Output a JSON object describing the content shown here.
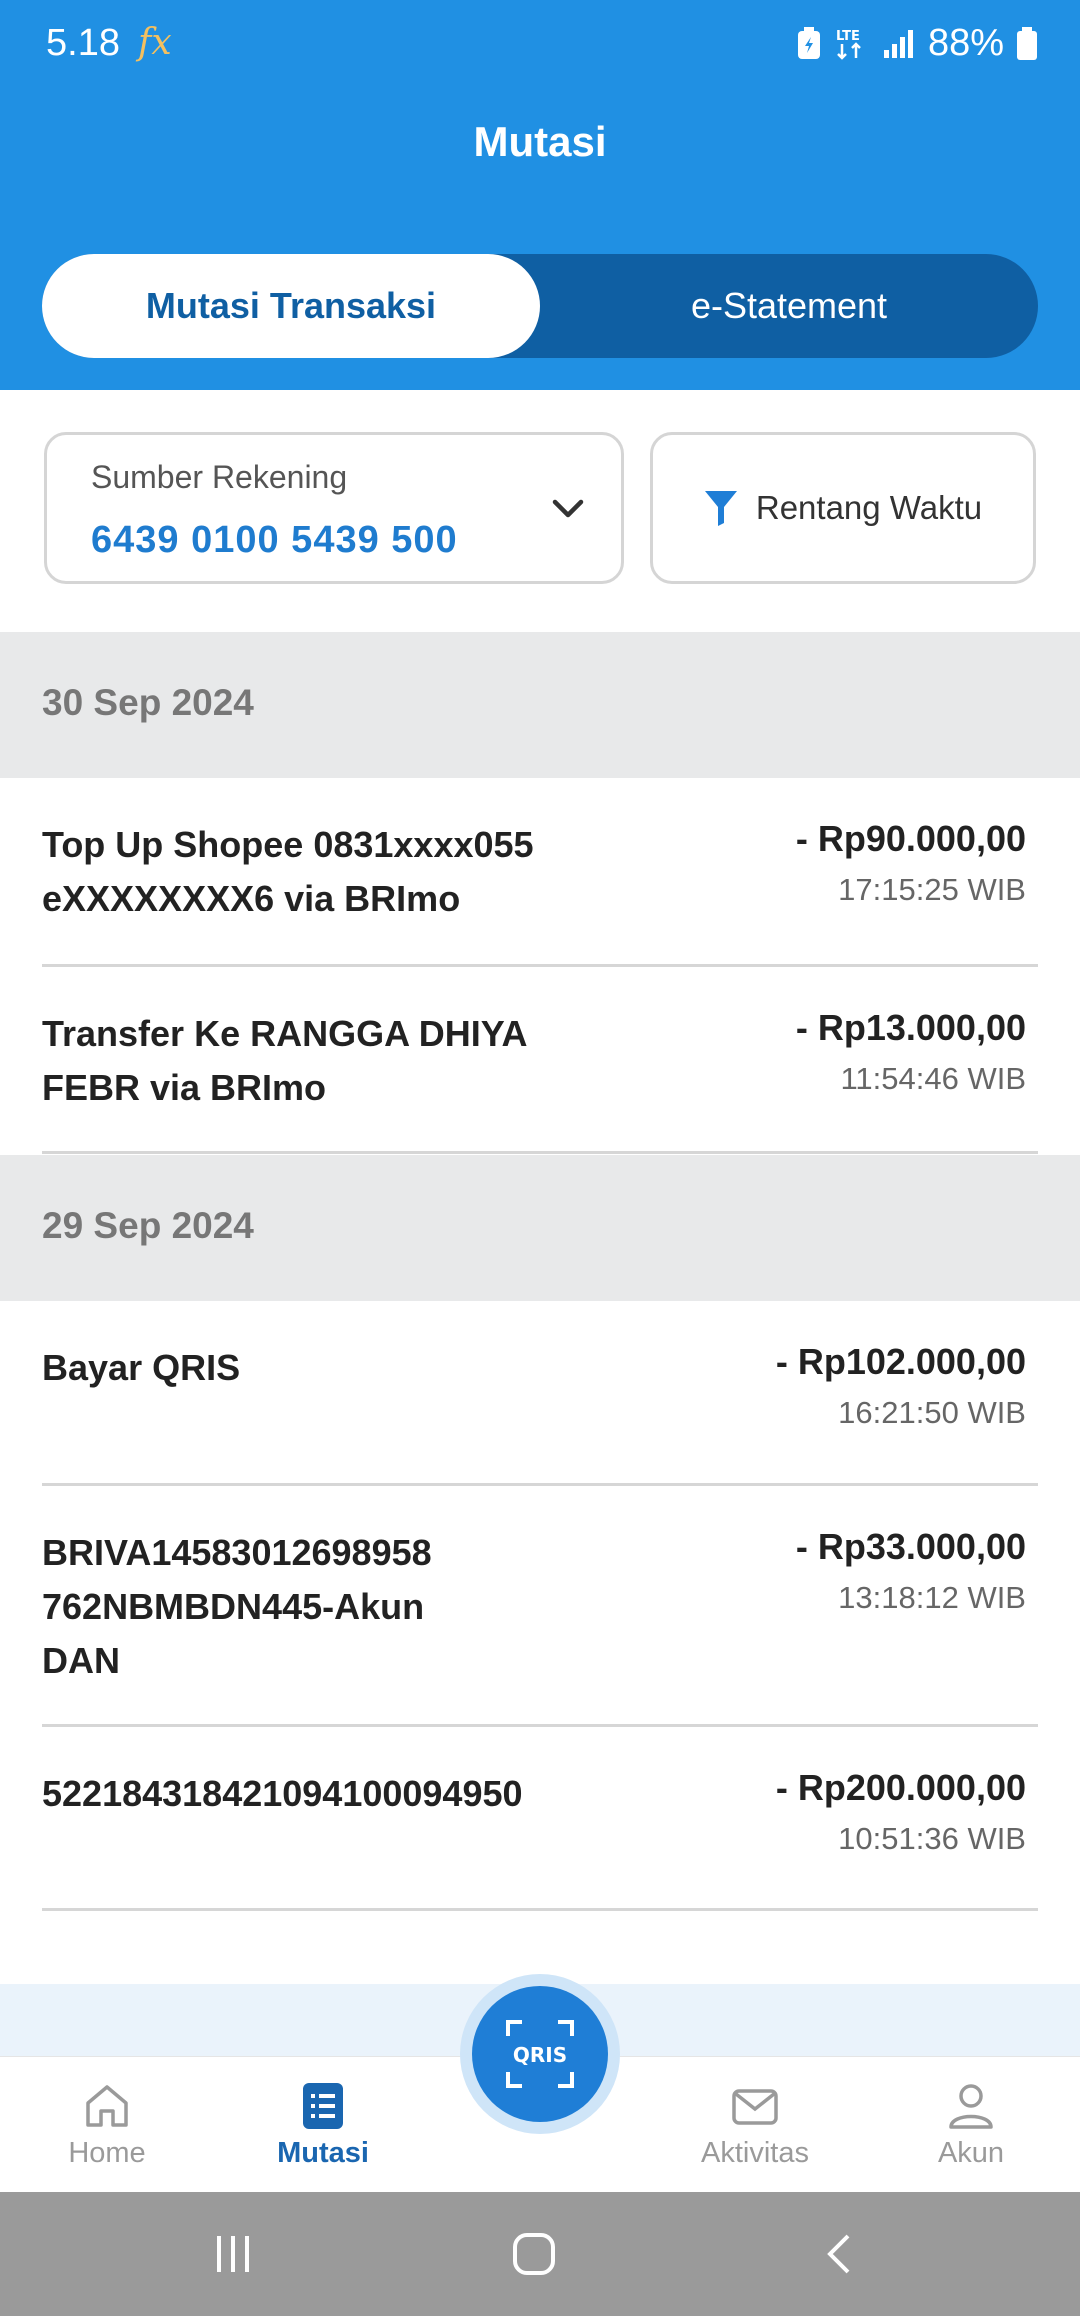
{
  "status_bar": {
    "time": "5.18",
    "fx": "fx",
    "network": "LTE",
    "battery": "88%"
  },
  "header": {
    "title": "Mutasi"
  },
  "tabs": [
    {
      "label": "Mutasi Transaksi",
      "active": true
    },
    {
      "label": "e-Statement",
      "active": false
    }
  ],
  "account_selector": {
    "label": "Sumber Rekening",
    "value": "6439 0100 5439 500"
  },
  "date_range_button": {
    "label": "Rentang Waktu"
  },
  "groups": [
    {
      "date": "30 Sep 2024",
      "transactions": [
        {
          "desc": "Top Up Shopee 0831xxxx055 eXXXXXXXX6 via BRImo",
          "amount": "- Rp90.000,00",
          "time": "17:15:25 WIB"
        },
        {
          "desc": "Transfer Ke RANGGA DHIYA FEBR via BRImo",
          "amount": "- Rp13.000,00",
          "time": "11:54:46 WIB"
        }
      ]
    },
    {
      "date": "29 Sep 2024",
      "transactions": [
        {
          "desc": "Bayar QRIS",
          "amount": "- Rp102.000,00",
          "time": "16:21:50 WIB"
        },
        {
          "desc": "BRIVA14583012698958 762NBMBDN445-Akun DAN",
          "amount": "- Rp33.000,00",
          "time": "13:18:12 WIB"
        },
        {
          "desc": "52218431842109410009495​0",
          "amount": "- Rp200.000,00",
          "time": "10:51:36 WIB"
        }
      ]
    }
  ],
  "bottom_nav": [
    {
      "label": "Home",
      "icon": "home-icon",
      "active": false
    },
    {
      "label": "Mutasi",
      "icon": "list-icon",
      "active": true
    },
    {
      "label": "QRIS",
      "icon": "qris-scan-icon"
    },
    {
      "label": "Aktivitas",
      "icon": "mail-icon",
      "active": false
    },
    {
      "label": "Akun",
      "icon": "user-icon",
      "active": false
    }
  ],
  "colors": {
    "primary": "#2090e3",
    "dark_primary": "#0f5fa3",
    "accent_text": "#1f7ccf",
    "date_bg": "#e8e9ea"
  }
}
